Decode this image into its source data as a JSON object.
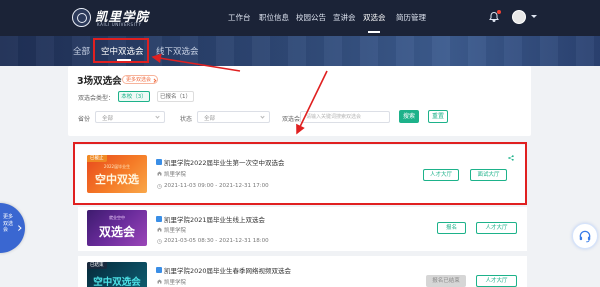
{
  "header": {
    "logo_title": "凯里学院",
    "logo_subtitle": "KAILI UNIVERSITY",
    "nav": [
      {
        "label": "工作台"
      },
      {
        "label": "职位信息"
      },
      {
        "label": "校园公告"
      },
      {
        "label": "宣讲会"
      },
      {
        "label": "双选会",
        "active": true
      },
      {
        "label": "简历管理"
      }
    ]
  },
  "tabs": [
    {
      "label": "全部"
    },
    {
      "label": "空中双选会",
      "active": true
    },
    {
      "label": "线下双选会"
    }
  ],
  "panel": {
    "title": "3场双选会",
    "more_link": "更多双选会",
    "type_label": "双选会类型：",
    "type_chips": [
      {
        "label": "本校（3）",
        "active": true
      },
      {
        "label": "已报名（1）"
      }
    ],
    "province_label": "省份",
    "province_value": "全部",
    "status_label": "状态",
    "status_value": "全部",
    "fair_label": "双选会",
    "search_placeholder": "请输入关键词搜索双选会",
    "search_button": "搜索",
    "reset_button": "重置"
  },
  "fairs": [
    {
      "badge": "已截止",
      "thumb_small": "2022届毕业生",
      "thumb_big": "空中双选",
      "title": "凯里学院2022届毕业生第一次空中双选会",
      "school": "凯里学院",
      "time": "2021-11-03 09:00 - 2021-12-31 17:00",
      "actions": [
        "人才大厅",
        "面试大厅"
      ]
    },
    {
      "thumb_small": "就业空中",
      "thumb_big": "双选会",
      "title": "凯里学院2021届毕业生线上双选会",
      "school": "凯里学院",
      "time": "2021-03-05 08:30 - 2021-12-31 18:00",
      "actions": [
        "报名",
        "人才大厅"
      ]
    },
    {
      "badge": "已结束",
      "thumb_big": "空中双选会",
      "title": "凯里学院2020届毕业生春季网络视频双选会",
      "school": "凯里学院",
      "actions": [
        "报名已结束",
        "人才大厅"
      ]
    }
  ],
  "side_tab": {
    "label": "更多双选会"
  },
  "colors": {
    "header_bg": "#1b2337",
    "accent": "#1db28a",
    "annotation": "#e02020",
    "side_float": "#3a67d1"
  }
}
